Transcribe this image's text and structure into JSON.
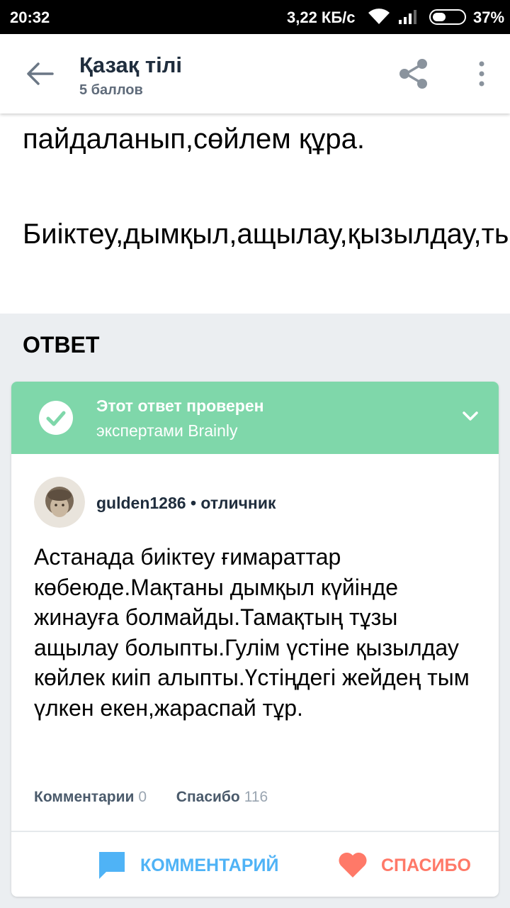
{
  "status_bar": {
    "time": "20:32",
    "speed": "3,22 КБ/с",
    "battery": "37%",
    "battery_level": 0.37
  },
  "app_bar": {
    "title": "Қазақ тілі",
    "subtitle": "5 баллов",
    "icons": [
      "back-arrow-icon",
      "share-icon",
      "more-vertical-icon"
    ]
  },
  "question": {
    "line1": "пайдаланып,сөйлем құра.",
    "line2": "Биіктеу,дымқыл,ащылау,қызылдау,тымүлкен."
  },
  "answer_heading": "ОТВЕТ",
  "verified": {
    "title": "Этот ответ проверен",
    "subtitle": "экспертами Brainly"
  },
  "author": {
    "name": "gulden1286",
    "rank": "отличник"
  },
  "answer_text": "Астанада биіктеу ғимараттар көбеюде.Мақтаны дымқыл күйінде жинауға болмайды.Тамақтың тұзы ащылау болыпты.Гулім үстіне қызылдау көйлек киіп алыпты.Үстіңдегі жейдең тым үлкен екен,жараспай тұр.",
  "stats": {
    "comments_label": "Комментарии",
    "comments_count": "0",
    "thanks_label": "Спасибо",
    "thanks_count": "116"
  },
  "actions": {
    "comment_label": "КОММЕНТАРИЙ",
    "thanks_label": "СПАСИБО"
  },
  "colors": {
    "verified_bg": "#7fd7aa",
    "comment_blue": "#4fb3f6",
    "thanks_red": "#ff7968",
    "title_dark": "#1f2d3d"
  }
}
